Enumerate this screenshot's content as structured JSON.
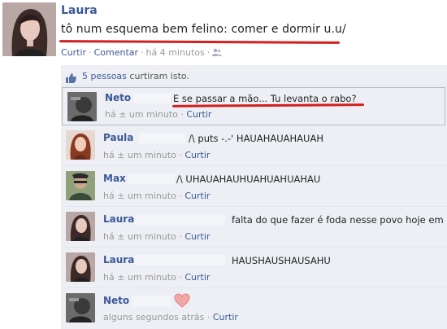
{
  "post": {
    "author": "Laura",
    "text": "tô num esquema bem felino: comer e dormir u.u/",
    "actions": {
      "like": "Curtir",
      "comment": "Comentar",
      "time": "há 4 minutos"
    }
  },
  "likes": {
    "count_text": "5 pessoas",
    "suffix": " curtiram isto."
  },
  "comments": [
    {
      "author": "Neto",
      "text": "E se passar a mão... Tu levanta o rabo?",
      "time": "há ± um minuto",
      "like": "Curtir"
    },
    {
      "author": "Paula",
      "text": "/\\ puts -.-' HAUAHAUAHAUAH",
      "time": "há ± um minuto",
      "like": "Curtir"
    },
    {
      "author": "Max",
      "text": "/\\ UHAUAHAUHUAHUAHUAHAU",
      "time": "há ± um minuto",
      "like": "Curtir"
    },
    {
      "author": "Laura",
      "text": "falta do que fazer é foda nesse povo hoje em dia!",
      "time": "há ± um minuto",
      "like": "Curtir"
    },
    {
      "author": "Laura",
      "text": "HAUSHAUSHAUSAHU",
      "time": "há ± um minuto",
      "like": "Curtir"
    },
    {
      "author": "Neto",
      "text": "",
      "time": "alguns segundos atrás",
      "like": "Curtir"
    }
  ],
  "icons": {
    "like": "thumbs-up-icon",
    "audience": "friends-icon",
    "heart": "heart-icon"
  },
  "colors": {
    "link": "#3b5998",
    "highlight": "#d31f1f",
    "ufi_bg": "#edeff4"
  }
}
